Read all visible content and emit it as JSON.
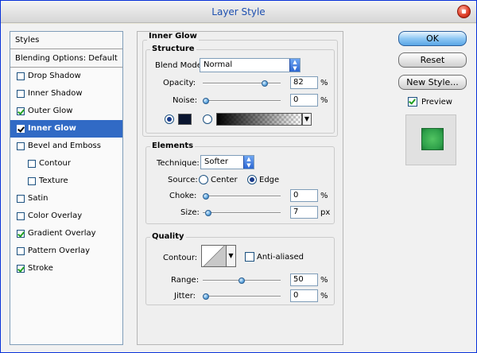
{
  "window": {
    "title": "Layer Style"
  },
  "styles": {
    "header": "Styles",
    "blending": "Blending Options: Default",
    "items": [
      {
        "label": "Drop Shadow",
        "checked": false
      },
      {
        "label": "Inner Shadow",
        "checked": false
      },
      {
        "label": "Outer Glow",
        "checked": true
      },
      {
        "label": "Inner Glow",
        "checked": true,
        "selected": true
      },
      {
        "label": "Bevel and Emboss",
        "checked": false
      },
      {
        "label": "Contour",
        "checked": false,
        "sub": true
      },
      {
        "label": "Texture",
        "checked": false,
        "sub": true
      },
      {
        "label": "Satin",
        "checked": false
      },
      {
        "label": "Color Overlay",
        "checked": false
      },
      {
        "label": "Gradient Overlay",
        "checked": true
      },
      {
        "label": "Pattern Overlay",
        "checked": false
      },
      {
        "label": "Stroke",
        "checked": true
      }
    ]
  },
  "inner_glow": {
    "title": "Inner Glow",
    "structure": {
      "title": "Structure",
      "blend_mode_label": "Blend Mode:",
      "blend_mode": "Normal",
      "opacity_label": "Opacity:",
      "opacity": "82",
      "opacity_unit": "%",
      "opacity_level": 0.82,
      "noise_label": "Noise:",
      "noise": "0",
      "noise_unit": "%",
      "noise_level": 0,
      "glow_color": "#0a1530"
    },
    "elements": {
      "title": "Elements",
      "technique_label": "Technique:",
      "technique": "Softer",
      "source_label": "Source:",
      "source_center": "Center",
      "source_edge": "Edge",
      "source_selected": "Edge",
      "choke_label": "Choke:",
      "choke": "0",
      "choke_unit": "%",
      "choke_level": 0,
      "size_label": "Size:",
      "size": "7",
      "size_unit": "px",
      "size_level": 0.03
    },
    "quality": {
      "title": "Quality",
      "contour_label": "Contour:",
      "anti_aliased_label": "Anti-aliased",
      "anti_aliased": false,
      "range_label": "Range:",
      "range": "50",
      "range_unit": "%",
      "range_level": 0.5,
      "jitter_label": "Jitter:",
      "jitter": "0",
      "jitter_unit": "%",
      "jitter_level": 0
    }
  },
  "buttons": {
    "ok": "OK",
    "reset": "Reset",
    "new_style": "New Style..."
  },
  "preview": {
    "label": "Preview",
    "checked": true,
    "color": "#2ea04a"
  }
}
